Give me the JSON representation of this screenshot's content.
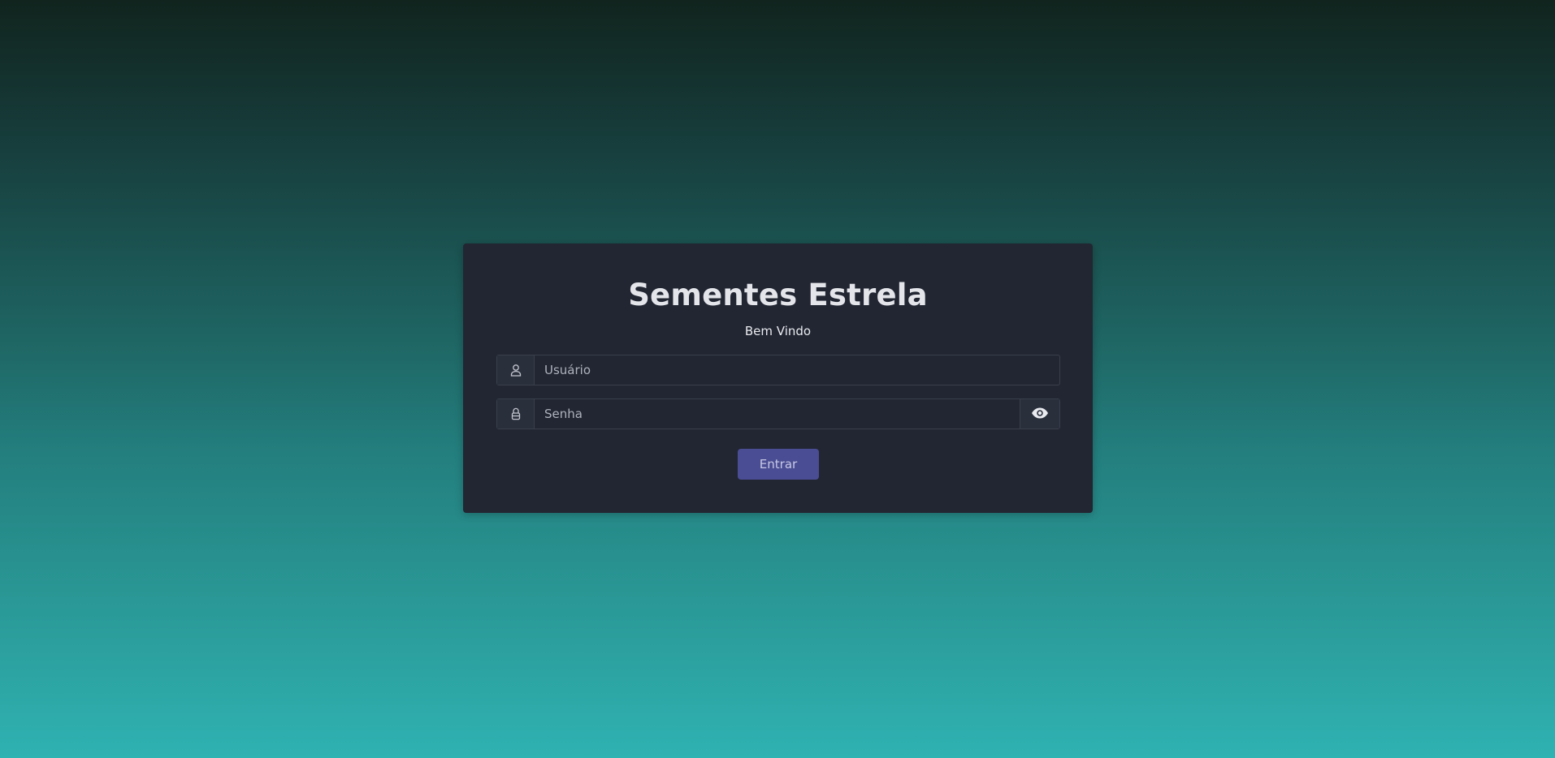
{
  "card": {
    "title": "Sementes Estrela",
    "subtitle": "Bem Vindo"
  },
  "form": {
    "username": {
      "value": "",
      "placeholder": "Usuário",
      "icon": "user-icon"
    },
    "password": {
      "value": "",
      "placeholder": "Senha",
      "icon": "lock-icon",
      "toggle_icon": "eye-icon"
    },
    "submit_label": "Entrar"
  },
  "colors": {
    "card_background": "#222632",
    "button_background": "#4a4d93",
    "gradient_top": "#11241e",
    "gradient_bottom": "#2fb2b2"
  }
}
